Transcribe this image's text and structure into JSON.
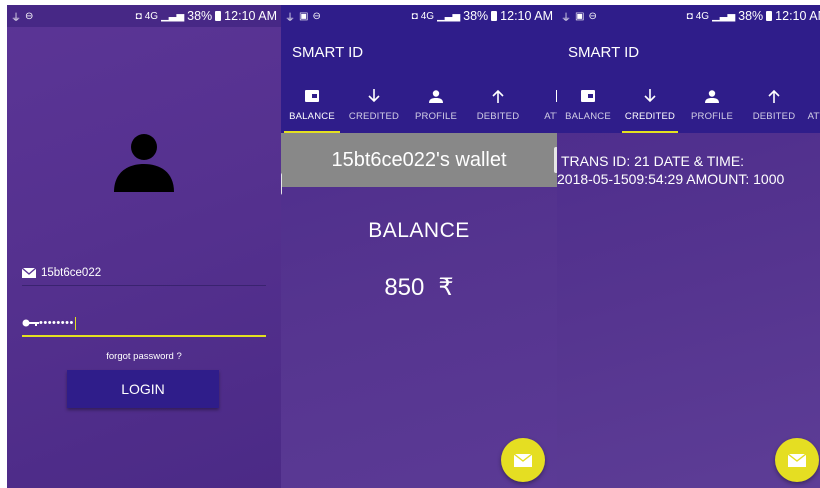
{
  "status": {
    "time": "12:10 AM",
    "battery": "38%",
    "network": "4G"
  },
  "login": {
    "username": "15bt6ce022",
    "password_mask": "••••••••",
    "forgot_label": "forgot password ?",
    "login_label": "LOGIN"
  },
  "app": {
    "title": "SMART ID",
    "tabs": [
      {
        "label": "BALANCE",
        "icon": "wallet-icon"
      },
      {
        "label": "CREDITED",
        "icon": "arrow-down-icon"
      },
      {
        "label": "PROFILE",
        "icon": "person-icon"
      },
      {
        "label": "DEBITED",
        "icon": "arrow-up-icon"
      },
      {
        "label": "ATTEN",
        "icon": "attendance-icon"
      }
    ],
    "tabs_short": [
      {
        "label": "BALANCE"
      },
      {
        "label": "CREDITED"
      },
      {
        "label": "PROFILE"
      },
      {
        "label": "DEBITED"
      },
      {
        "label": "ATT"
      }
    ]
  },
  "wallet": {
    "heading": "15bt6ce022's wallet",
    "balance_label": "BALANCE",
    "balance_amount": "850",
    "currency": "₹"
  },
  "credited": {
    "line1": "TRANS ID: 21  DATE & TIME:",
    "line2": "2018-05-1509:54:29  AMOUNT: 1000"
  },
  "colors": {
    "appbar": "#2f1d8a",
    "accent": "#e3e020",
    "fab": "#e5de22",
    "card": "#888888"
  }
}
